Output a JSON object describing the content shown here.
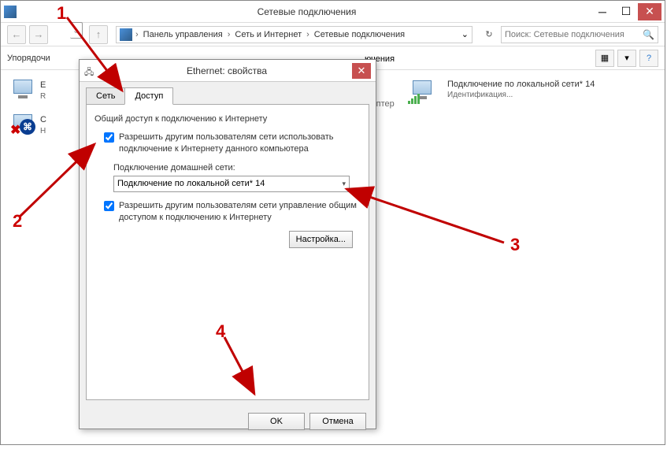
{
  "main_window": {
    "title": "Сетевые подключения",
    "nav": {
      "back": "←",
      "forward": "→",
      "up": "↑"
    },
    "breadcrumb": {
      "sep": "›",
      "parts": [
        "Панель управления",
        "Сеть и Интернет",
        "Сетевые подключения"
      ],
      "dropdown": "⌄",
      "refresh": "↻"
    },
    "search": {
      "placeholder": "Поиск: Сетевые подключения",
      "icon": "🔍"
    },
    "toolbar": {
      "label": "Упорядочи"
    },
    "partial_text": "ючения",
    "connections": {
      "eth": {
        "title": "E",
        "sub": "R"
      },
      "bt": {
        "title": "С",
        "sub": "Н"
      },
      "lan": {
        "title": "Подключение по локальной сети* 14",
        "sub": "Идентификация..."
      },
      "adapter": "адаптер"
    }
  },
  "dialog": {
    "title": "Ethernet: свойства",
    "close": "✕",
    "tabs": {
      "network": "Сеть",
      "sharing": "Доступ"
    },
    "group_label": "Общий доступ к подключению к Интернету",
    "cb1_label": "Разрешить другим пользователям сети использовать подключение к Интернету данного компьютера",
    "sub_label": "Подключение домашней сети:",
    "dropdown_value": "Подключение по локальной сети* 14",
    "cb2_label": "Разрешить другим пользователям сети управление общим доступом к подключению к Интернету",
    "settings_btn": "Настройка...",
    "ok": "OK",
    "cancel": "Отмена"
  },
  "annotations": {
    "n1": "1",
    "n2": "2",
    "n3": "3",
    "n4": "4"
  }
}
